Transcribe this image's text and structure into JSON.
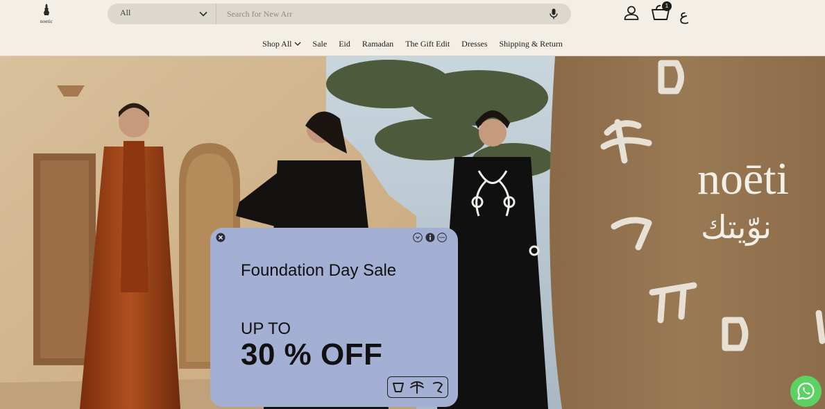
{
  "header": {
    "logo_text": "noetic",
    "search": {
      "category_selected": "All",
      "placeholder": "Search for New Arr"
    },
    "cart_count": "1",
    "language_toggle": "ع"
  },
  "nav": {
    "items": [
      {
        "label": "Shop All",
        "has_dropdown": true
      },
      {
        "label": "Sale"
      },
      {
        "label": "Eid"
      },
      {
        "label": "Ramadan"
      },
      {
        "label": "The Gift Edit"
      },
      {
        "label": "Dresses"
      },
      {
        "label": "Shipping & Return"
      }
    ]
  },
  "hero": {
    "brand_latin": "noēti",
    "brand_arabic": "نوّيتك"
  },
  "popup": {
    "title": "Foundation Day Sale",
    "up_to": "UP TO",
    "discount": "30 % OFF",
    "background_color": "#a3afd3"
  },
  "icons": {
    "account": "account-icon",
    "cart": "cart-icon",
    "mic": "mic-icon",
    "whatsapp": "whatsapp-icon"
  }
}
